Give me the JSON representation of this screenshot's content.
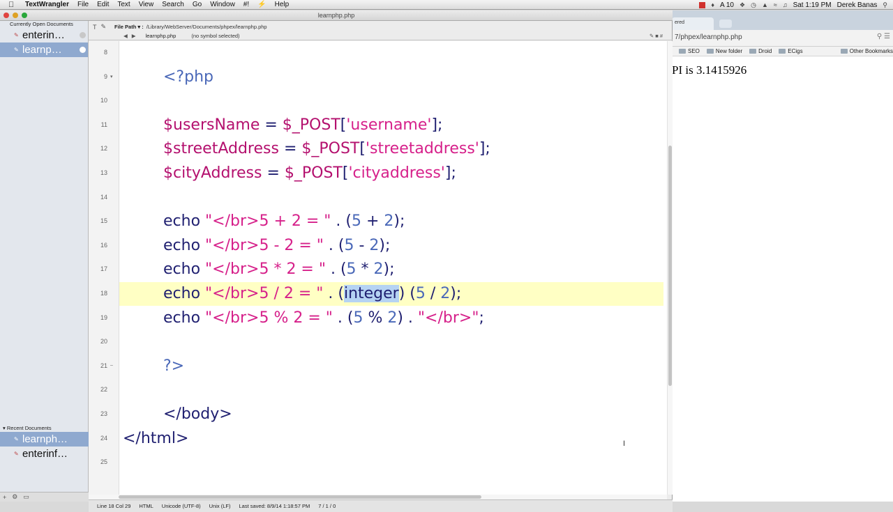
{
  "menubar": {
    "app_name": "TextWrangler",
    "items": [
      "File",
      "Edit",
      "Text",
      "View",
      "Search",
      "Go",
      "Window",
      "#!",
      "Help"
    ],
    "battery_count": "10",
    "clock": "Sat 1:19 PM",
    "user": "Derek Banas"
  },
  "editor_window": {
    "title": "learnphp.php",
    "file_path_label": "File Path ▾ :",
    "file_path": "/Library/WebServer/Documents/phpex/learnphp.php",
    "nav_file": "learnphp.php",
    "symbol": "(no symbol selected)"
  },
  "sidebar": {
    "open_header": "Currently Open Documents",
    "open_docs": [
      "enterin…",
      "learnp…"
    ],
    "recent_header": "Recent Documents",
    "recent_docs": [
      "learnph…",
      "enterinf…"
    ]
  },
  "code_lines": [
    {
      "num": "8",
      "text": ""
    },
    {
      "num": "9",
      "text": "<?php"
    },
    {
      "num": "10",
      "text": ""
    },
    {
      "num": "11",
      "text": "$usersName = $_POST['username'];"
    },
    {
      "num": "12",
      "text": "$streetAddress = $_POST['streetaddress'];"
    },
    {
      "num": "13",
      "text": "$cityAddress = $_POST['cityaddress'];"
    },
    {
      "num": "14",
      "text": ""
    },
    {
      "num": "15",
      "text": "echo \"</br>5 + 2 = \" . (5 + 2);"
    },
    {
      "num": "16",
      "text": "echo \"</br>5 - 2 = \" . (5 - 2);"
    },
    {
      "num": "17",
      "text": "echo \"</br>5 * 2 = \" . (5 * 2);"
    },
    {
      "num": "18",
      "text": "echo \"</br>5 / 2 = \" . (integer) (5 / 2);"
    },
    {
      "num": "19",
      "text": "echo \"</br>5 % 2 = \" . (5 % 2) . \"</br>\";"
    },
    {
      "num": "20",
      "text": ""
    },
    {
      "num": "21",
      "text": "?>"
    },
    {
      "num": "22",
      "text": ""
    },
    {
      "num": "23",
      "text": "</body>"
    },
    {
      "num": "24",
      "text": "</html>"
    },
    {
      "num": "25",
      "text": ""
    }
  ],
  "statusbar": {
    "position": "Line 18 Col 29",
    "language": "HTML",
    "encoding": "Unicode (UTF-8)",
    "line_endings": "Unix (LF)",
    "last_saved": "Last saved: 8/9/14 1:18:57 PM",
    "counts": "7 / 1 / 0"
  },
  "browser": {
    "tab_label": "ered",
    "url": "7/phpex/learnphp.php",
    "bookmarks": [
      "SEO",
      "New folder",
      "Droid",
      "ECigs"
    ],
    "other_bookmarks": "Other Bookmarks",
    "output_text": "PI is 3.1415926"
  }
}
